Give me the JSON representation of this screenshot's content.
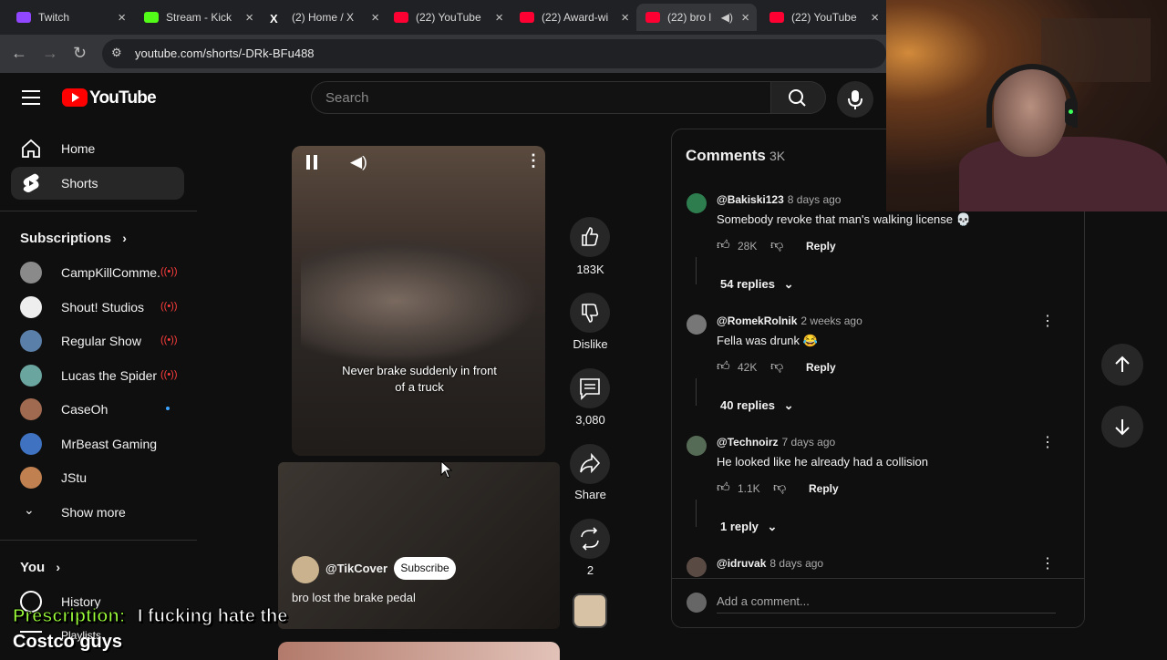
{
  "browser": {
    "tabs": [
      {
        "title": "Twitch",
        "color": "#9146ff",
        "active": false
      },
      {
        "title": "Stream - Kick",
        "color": "#53fc18",
        "active": false
      },
      {
        "title": "(2) Home / X",
        "color": "#ffffff",
        "active": false
      },
      {
        "title": "(22) YouTube",
        "color": "#ff0033",
        "active": false
      },
      {
        "title": "(22) Award-wi",
        "color": "#ff0033",
        "active": false
      },
      {
        "title": "(22) bro l",
        "color": "#ff0033",
        "active": true
      },
      {
        "title": "(22) YouTube",
        "color": "#ff0033",
        "active": false
      }
    ],
    "url": "youtube.com/shorts/-DRk-BFu488"
  },
  "header": {
    "logo_text": "YouTube",
    "search_placeholder": "Search"
  },
  "sidebar": {
    "items": [
      {
        "label": "Home",
        "icon": "home-icon"
      },
      {
        "label": "Shorts",
        "icon": "shorts-icon"
      }
    ],
    "subscriptions_title": "Subscriptions",
    "subscriptions": [
      {
        "name": "CampKillComme...",
        "status": "live",
        "color": "#8a8a8a"
      },
      {
        "name": "Shout! Studios",
        "status": "live",
        "color": "#eeeeee"
      },
      {
        "name": "Regular Show",
        "status": "live",
        "color": "#5a7fa8"
      },
      {
        "name": "Lucas the Spider",
        "status": "live",
        "color": "#6aa5a0"
      },
      {
        "name": "CaseOh",
        "status": "new",
        "color": "#a06a50"
      },
      {
        "name": "MrBeast Gaming",
        "status": "",
        "color": "#3f72c0"
      },
      {
        "name": "JStu",
        "status": "",
        "color": "#c08050"
      }
    ],
    "show_more": "Show more",
    "you_title": "You",
    "you_items": [
      {
        "label": "History"
      },
      {
        "label": "Playlists"
      }
    ]
  },
  "short": {
    "caption": "Never brake suddenly in front of a truck",
    "channel": "@TikCover",
    "subscribe": "Subscribe",
    "title": "bro lost the brake pedal",
    "actions": [
      {
        "name": "like",
        "label": "183K"
      },
      {
        "name": "dislike",
        "label": "Dislike"
      },
      {
        "name": "comments",
        "label": "3,080"
      },
      {
        "name": "share",
        "label": "Share"
      },
      {
        "name": "remix",
        "label": "2"
      }
    ]
  },
  "comments": {
    "title": "Comments",
    "count": "3K",
    "list": [
      {
        "user": "@Bakiski123",
        "time": "8 days ago",
        "text": "Somebody revoke that man's walking license 💀",
        "likes": "28K",
        "reply": "Reply",
        "replies": "54 replies",
        "color": "#2e7d4f"
      },
      {
        "user": "@RomekRolnik",
        "time": "2 weeks ago",
        "text": "Fella was drunk 😂",
        "likes": "42K",
        "reply": "Reply",
        "replies": "40 replies",
        "color": "#777777"
      },
      {
        "user": "@Technoirz",
        "time": "7 days ago",
        "text": "He looked like he already had a collision",
        "likes": "1.1K",
        "reply": "Reply",
        "replies": "1 reply",
        "color": "#556b55"
      },
      {
        "user": "@idruvak",
        "time": "8 days ago",
        "text": "",
        "likes": "",
        "reply": "",
        "replies": "",
        "color": "#5a4a44"
      }
    ],
    "add_placeholder": "Add a comment..."
  },
  "overlay": {
    "prefix": "Prescription:",
    "line1": "I fucking hate the",
    "line2": "Costco guys"
  }
}
